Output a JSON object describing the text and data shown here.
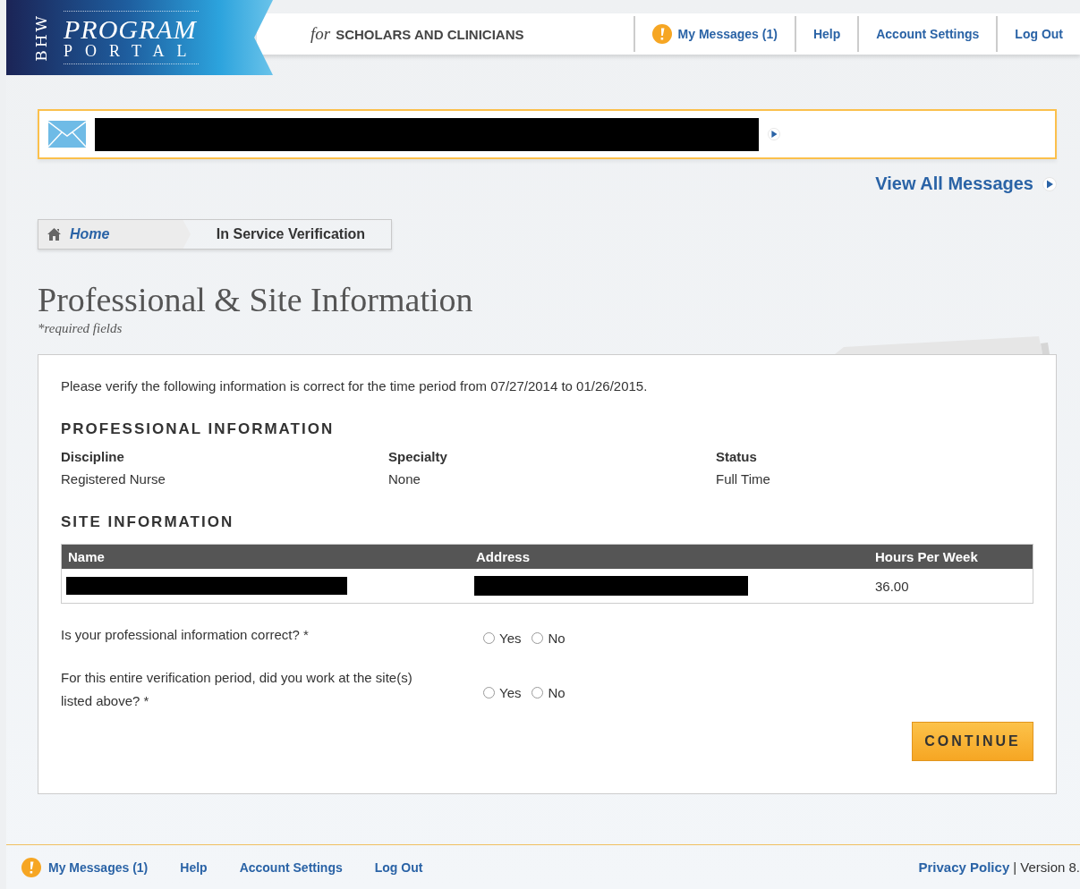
{
  "logo": {
    "side": "BHW",
    "line_1": "PROGRAM",
    "line_2": "PORTAL"
  },
  "tagline": {
    "prefix": "for",
    "text": "SCHOLARS AND CLINICIANS"
  },
  "top_nav": [
    {
      "label": "My Messages (1)",
      "kind": "alert"
    },
    {
      "label": "Help",
      "kind": "link"
    },
    {
      "label": "Account Settings",
      "kind": "link"
    },
    {
      "label": "Log Out",
      "kind": "link"
    }
  ],
  "view_all_messages": "View All Messages",
  "breadcrumb": [
    {
      "label": "Home",
      "kind": "home"
    },
    {
      "label": "In Service Verification",
      "kind": "current"
    }
  ],
  "page_title": "Professional & Site Information",
  "required_note": "*required fields",
  "intro": "Please verify the following information is correct for the time period from 07/27/2014 to 01/26/2015.",
  "professional": {
    "heading": "PROFESSIONAL INFORMATION",
    "fields": [
      {
        "label": "Discipline",
        "value": "Registered Nurse"
      },
      {
        "label": "Specialty",
        "value": "None"
      },
      {
        "label": "Status",
        "value": "Full Time"
      }
    ]
  },
  "site": {
    "heading": "SITE INFORMATION",
    "columns": [
      "Name",
      "Address",
      "Hours Per Week"
    ],
    "rows": [
      {
        "hours": "36.00"
      }
    ]
  },
  "questions": [
    {
      "text": "Is your professional information correct? *",
      "options": [
        {
          "label": "Yes",
          "selected": false
        },
        {
          "label": "No",
          "selected": false
        }
      ]
    },
    {
      "text": "For this entire verification period, did you work at the site(s) listed above? *",
      "options": [
        {
          "label": "Yes",
          "selected": false
        },
        {
          "label": "No",
          "selected": false
        }
      ]
    }
  ],
  "continue_button": "CONTINUE",
  "footer": {
    "links": [
      {
        "label": "My Messages (1)",
        "kind": "alert"
      },
      {
        "label": "Help",
        "kind": "link"
      },
      {
        "label": "Account Settings",
        "kind": "link"
      },
      {
        "label": "Log Out",
        "kind": "link"
      }
    ],
    "privacy": "Privacy Policy",
    "version": "| Version 8."
  }
}
